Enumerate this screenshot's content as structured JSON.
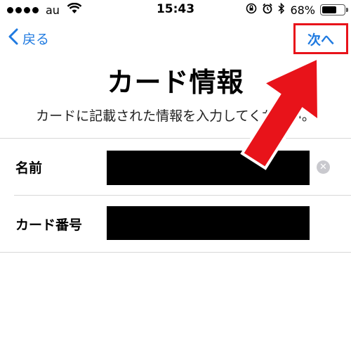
{
  "status_bar": {
    "carrier": "au",
    "time": "15:43",
    "battery_percent": "68%",
    "battery_level": 0.68
  },
  "nav": {
    "back_label": "戻る",
    "next_label": "次へ"
  },
  "header": {
    "title": "カード情報",
    "subtitle": "カードに記載された情報を入力してください。"
  },
  "form": {
    "fields": [
      {
        "label": "名前",
        "value": ""
      },
      {
        "label": "カード番号",
        "value": ""
      }
    ]
  },
  "annotation": {
    "highlight_color": "#e8131a"
  }
}
